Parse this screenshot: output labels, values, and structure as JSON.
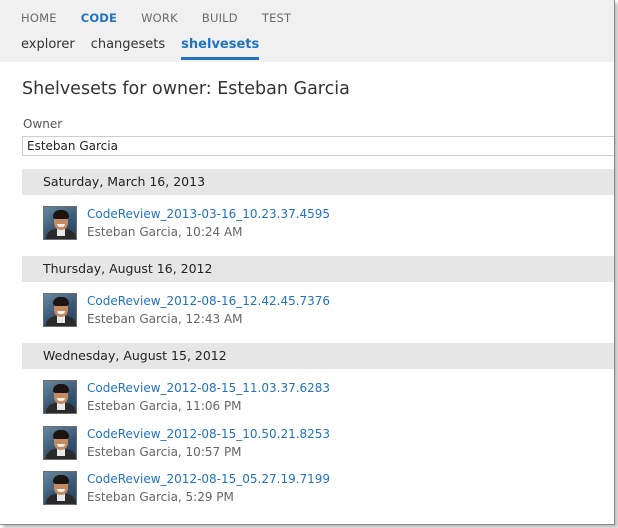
{
  "top_nav": [
    {
      "label": "HOME",
      "active": false
    },
    {
      "label": "CODE",
      "active": true
    },
    {
      "label": "WORK",
      "active": false
    },
    {
      "label": "BUILD",
      "active": false
    },
    {
      "label": "TEST",
      "active": false
    }
  ],
  "sub_nav": [
    {
      "label": "explorer",
      "active": false
    },
    {
      "label": "changesets",
      "active": false
    },
    {
      "label": "shelvesets",
      "active": true
    }
  ],
  "page_title": "Shelvesets for owner: Esteban Garcia",
  "owner": {
    "label": "Owner",
    "value": "Esteban Garcia"
  },
  "groups": [
    {
      "date": "Saturday, March 16, 2013",
      "items": [
        {
          "name": "CodeReview_2013-03-16_10.23.37.4595",
          "meta": "Esteban Garcia, 10:24 AM"
        }
      ]
    },
    {
      "date": "Thursday, August 16, 2012",
      "items": [
        {
          "name": "CodeReview_2012-08-16_12.42.45.7376",
          "meta": "Esteban Garcia, 12:43 AM"
        }
      ]
    },
    {
      "date": "Wednesday, August 15, 2012",
      "items": [
        {
          "name": "CodeReview_2012-08-15_11.03.37.6283",
          "meta": "Esteban Garcia, 11:06 PM"
        },
        {
          "name": "CodeReview_2012-08-15_10.50.21.8253",
          "meta": "Esteban Garcia, 10:57 PM"
        },
        {
          "name": "CodeReview_2012-08-15_05.27.19.7199",
          "meta": "Esteban Garcia, 5:29 PM"
        }
      ]
    }
  ],
  "colors": {
    "accent": "#1f73c1",
    "header_bg": "#f0f0f0",
    "group_bg": "#e6e6e6"
  },
  "icons": {
    "avatar": "user-photo-icon"
  }
}
